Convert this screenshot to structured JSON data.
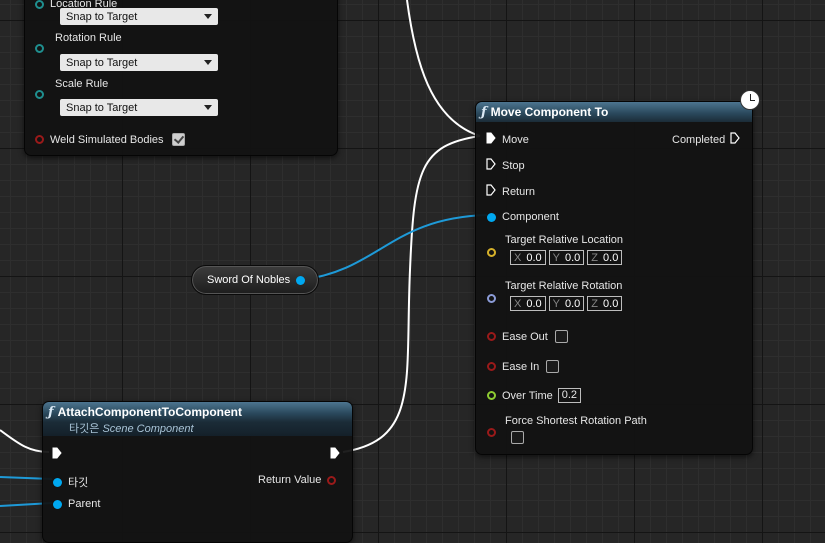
{
  "attach_node": {
    "location_rule_label": "Location Rule",
    "location_rule_value": "Snap to Target",
    "rotation_rule_label": "Rotation Rule",
    "rotation_rule_value": "Snap to Target",
    "scale_rule_label": "Scale Rule",
    "scale_rule_value": "Snap to Target",
    "weld_label": "Weld Simulated Bodies",
    "weld_checked": true
  },
  "move_node": {
    "title": "Move Component To",
    "exec_move": "Move",
    "exec_stop": "Stop",
    "exec_return": "Return",
    "completed": "Completed",
    "component": "Component",
    "target_location_label": "Target Relative Location",
    "target_location": {
      "x": "0.0",
      "y": "0.0",
      "z": "0.0"
    },
    "target_rotation_label": "Target Relative Rotation",
    "target_rotation": {
      "x": "0.0",
      "y": "0.0",
      "z": "0.0"
    },
    "axis_x": "X",
    "axis_y": "Y",
    "axis_z": "Z",
    "ease_out": "Ease Out",
    "ease_out_checked": false,
    "ease_in": "Ease In",
    "ease_in_checked": false,
    "over_time_label": "Over Time",
    "over_time_value": "0.2",
    "force_shortest_label": "Force Shortest Rotation Path",
    "force_shortest_checked": false
  },
  "variable_node": {
    "label": "Sword Of Nobles"
  },
  "attach_component_node": {
    "title": "AttachComponentToComponent",
    "subtitle_prefix": "타깃은",
    "subtitle_class": "Scene Component",
    "target_pin": "타깃",
    "parent_pin": "Parent",
    "return_value": "Return Value"
  },
  "colors": {
    "exec": "#ffffff",
    "object_pin": "#00a8f0",
    "vector_pin": "#d6b12a",
    "rotator_pin": "#8c9cd8",
    "bool_pin": "#9a1a1a",
    "float_pin": "#8ecc32",
    "enum_pin": "#1f8f8f",
    "header": "#3c6480"
  },
  "icons": {
    "function": "function-icon",
    "latent": "clock-icon"
  }
}
